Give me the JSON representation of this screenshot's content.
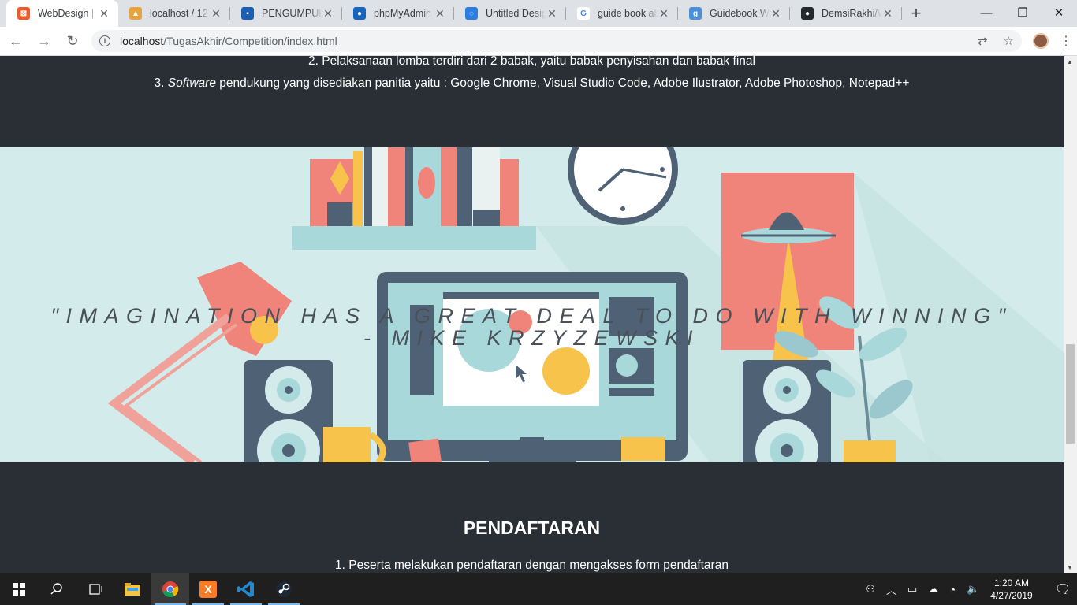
{
  "browser": {
    "tabs": [
      {
        "title": "WebDesign | C",
        "favicon_color": "#f05a28",
        "favicon_glyph": "⊠",
        "active": true
      },
      {
        "title": "localhost / 127",
        "favicon_color": "#e8a33b",
        "favicon_glyph": "▲",
        "active": false
      },
      {
        "title": "PENGUMPULA",
        "favicon_color": "#1a5fb4",
        "favicon_glyph": "▪",
        "active": false
      },
      {
        "title": "phpMyAdmin",
        "favicon_color": "#1565c0",
        "favicon_glyph": "●",
        "active": false
      },
      {
        "title": "Untitled Desig",
        "favicon_color": "#2a7de1",
        "favicon_glyph": "◌",
        "active": false
      },
      {
        "title": "guide book ab",
        "favicon_color": "#ffffff",
        "favicon_glyph": "G",
        "active": false
      },
      {
        "title": "Guidebook We",
        "favicon_color": "#4a90d9",
        "favicon_glyph": "g",
        "active": false
      },
      {
        "title": "DemsiRakhi/W",
        "favicon_color": "#24292e",
        "favicon_glyph": "●",
        "active": false
      }
    ],
    "url_host": "localhost",
    "url_path": "/TugasAkhir/Competition/index.html"
  },
  "page": {
    "rules": {
      "item2": "2. Pelaksanaan lomba terdiri dari 2 babak, yaitu babak penyisahan dan babak final",
      "item3_prefix": "3. ",
      "item3_em": "Software",
      "item3_rest": " pendukung yang disediakan panitia yaitu : Google Chrome, Visual Studio Code, Adobe Ilustrator, Adobe Photoshop, Notepad++"
    },
    "quote_line1": "\"IMAGINATION HAS A GREAT DEAL TO DO WITH WINNING\"",
    "quote_line2": "- MIKE KRZYZEWSKI",
    "registration": {
      "title": "PENDAFTARAN",
      "item1": "1. Peserta melakukan pendaftaran dengan mengakses form pendaftaran"
    }
  },
  "taskbar": {
    "time": "1:20 AM",
    "date": "4/27/2019"
  }
}
